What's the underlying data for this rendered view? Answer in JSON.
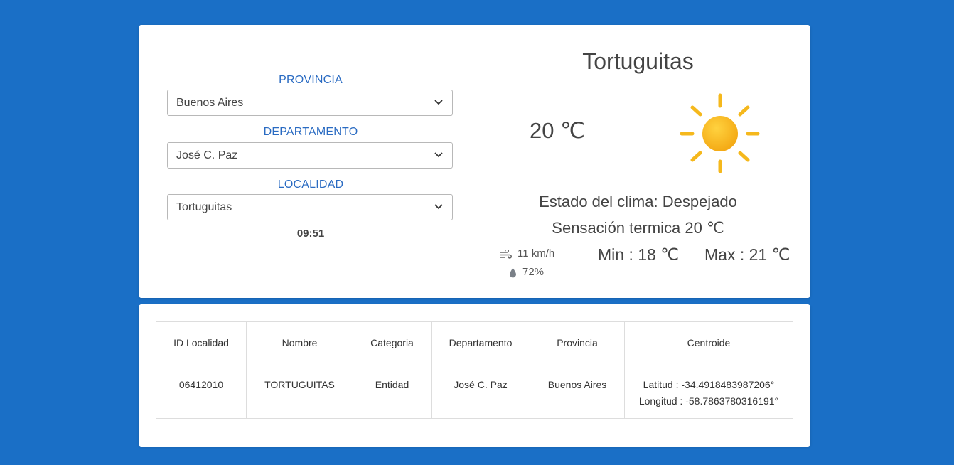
{
  "form": {
    "provincia": {
      "label": "PROVINCIA",
      "value": "Buenos Aires"
    },
    "departamento": {
      "label": "DEPARTAMENTO",
      "value": "José C. Paz"
    },
    "localidad": {
      "label": "LOCALIDAD",
      "value": "Tortuguitas"
    },
    "time": "09:51"
  },
  "weather": {
    "city": "Tortuguitas",
    "temp": "20 ℃",
    "icon": "sun-icon",
    "estado": "Estado del clima: Despejado",
    "sensacion": "Sensación termica 20 ℃",
    "wind": "11 km/h",
    "humidity": "72%",
    "min": "Min : 18 ℃",
    "max": "Max : 21 ℃"
  },
  "table": {
    "headers": [
      "ID Localidad",
      "Nombre",
      "Categoria",
      "Departamento",
      "Provincia",
      "Centroide"
    ],
    "row": {
      "id": "06412010",
      "nombre": "TORTUGUITAS",
      "categoria": "Entidad",
      "departamento": "José C. Paz",
      "provincia": "Buenos Aires",
      "latitud": "Latitud : -34.4918483987206°",
      "longitud": "Longitud : -58.7863780316191°"
    }
  },
  "colors": {
    "background": "#1a6fc6",
    "label_blue": "#2a6bc2",
    "sun": "#f5b81c"
  }
}
